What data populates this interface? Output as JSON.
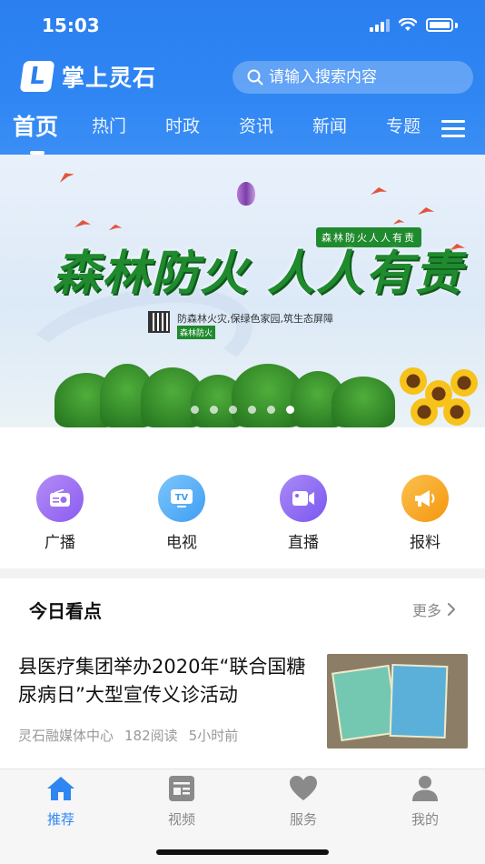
{
  "status_bar": {
    "time": "15:03"
  },
  "app": {
    "name": "掌上灵石",
    "logo_letter": "L"
  },
  "search": {
    "placeholder": "请输入搜索内容"
  },
  "tabs": [
    {
      "label": "首页",
      "active": true
    },
    {
      "label": "热门"
    },
    {
      "label": "时政"
    },
    {
      "label": "资讯"
    },
    {
      "label": "新闻"
    },
    {
      "label": "专题"
    }
  ],
  "banner": {
    "title": "森林防火 人人有责",
    "tag": "森林防火人人有责",
    "slogan": "防森林火灾,保绿色家园,筑生态屏障",
    "slogan_tag": "森林防火",
    "slide_count": 6,
    "active_slide": 6
  },
  "quick_links": [
    {
      "label": "广播",
      "icon": "radio-icon",
      "color": "#9b6ff0"
    },
    {
      "label": "电视",
      "icon": "tv-icon",
      "color": "#4aa8f5"
    },
    {
      "label": "直播",
      "icon": "video-camera-icon",
      "color": "#8a66f2"
    },
    {
      "label": "报料",
      "icon": "megaphone-icon",
      "color": "#f7a11d"
    }
  ],
  "today": {
    "title": "今日看点",
    "more": "更多",
    "news": {
      "title": "县医疗集团举办2020年“联合国糖尿病日”大型宣传义诊活动",
      "source": "灵石融媒体中心",
      "reads": "182阅读",
      "time": "5小时前"
    }
  },
  "bottom_nav": [
    {
      "label": "推荐",
      "icon": "home-icon",
      "active": true
    },
    {
      "label": "视频",
      "icon": "video-list-icon"
    },
    {
      "label": "服务",
      "icon": "heart-icon"
    },
    {
      "label": "我的",
      "icon": "user-icon"
    }
  ],
  "colors": {
    "primary": "#2f86f3",
    "banner_green": "#1f8a2e"
  }
}
